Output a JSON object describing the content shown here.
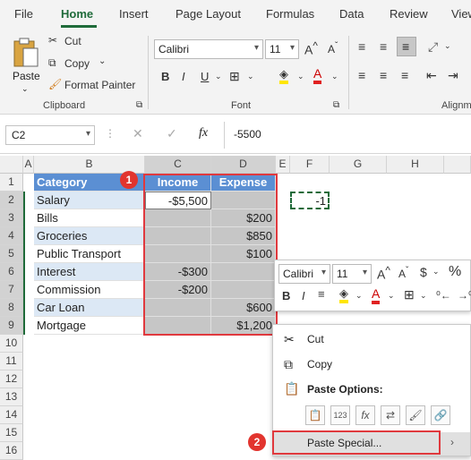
{
  "ribbon": {
    "tabs": [
      "File",
      "Home",
      "Insert",
      "Page Layout",
      "Formulas",
      "Data",
      "Review",
      "View"
    ],
    "clipboard": {
      "paste": "Paste",
      "cut": "Cut",
      "copy": "Copy",
      "format_painter": "Format Painter",
      "group": "Clipboard"
    },
    "font": {
      "name": "Calibri",
      "size": "11",
      "group": "Font",
      "bold": "B",
      "italic": "I",
      "underline": "U"
    },
    "alignment": {
      "group": "Alignm"
    }
  },
  "formula_bar": {
    "name_box": "C2",
    "fx": "fx",
    "value": "-5500"
  },
  "columns": [
    "A",
    "B",
    "C",
    "D",
    "E",
    "F",
    "G",
    "H"
  ],
  "rows": [
    "1",
    "2",
    "3",
    "4",
    "5",
    "6",
    "7",
    "8",
    "9",
    "10",
    "11",
    "12",
    "13",
    "14",
    "15",
    "16"
  ],
  "table": {
    "headers": [
      "Category",
      "Income",
      "Expense"
    ],
    "rows": [
      [
        "Salary",
        "-$5,500",
        ""
      ],
      [
        "Bills",
        "",
        "$200"
      ],
      [
        "Groceries",
        "",
        "$850"
      ],
      [
        "Public Transport",
        "",
        "$100"
      ],
      [
        "Interest",
        "-$300",
        ""
      ],
      [
        "Commission",
        "-$200",
        ""
      ],
      [
        "Car Loan",
        "",
        "$600"
      ],
      [
        "Mortgage",
        "",
        "$1,200"
      ]
    ]
  },
  "f2_value": "-1",
  "mini_toolbar": {
    "font": "Calibri",
    "size": "11",
    "percent": "%",
    "bold": "B",
    "italic": "I"
  },
  "context_menu": {
    "cut": "Cut",
    "copy": "Copy",
    "paste_options": "Paste Options:",
    "paste_special": "Paste Special..."
  },
  "badges": [
    "1",
    "2"
  ],
  "colors": {
    "accent_green": "#1f6b3a",
    "header_blue": "#5b8fd3",
    "band_blue": "#dce8f5",
    "highlight_red": "#e0393e"
  }
}
